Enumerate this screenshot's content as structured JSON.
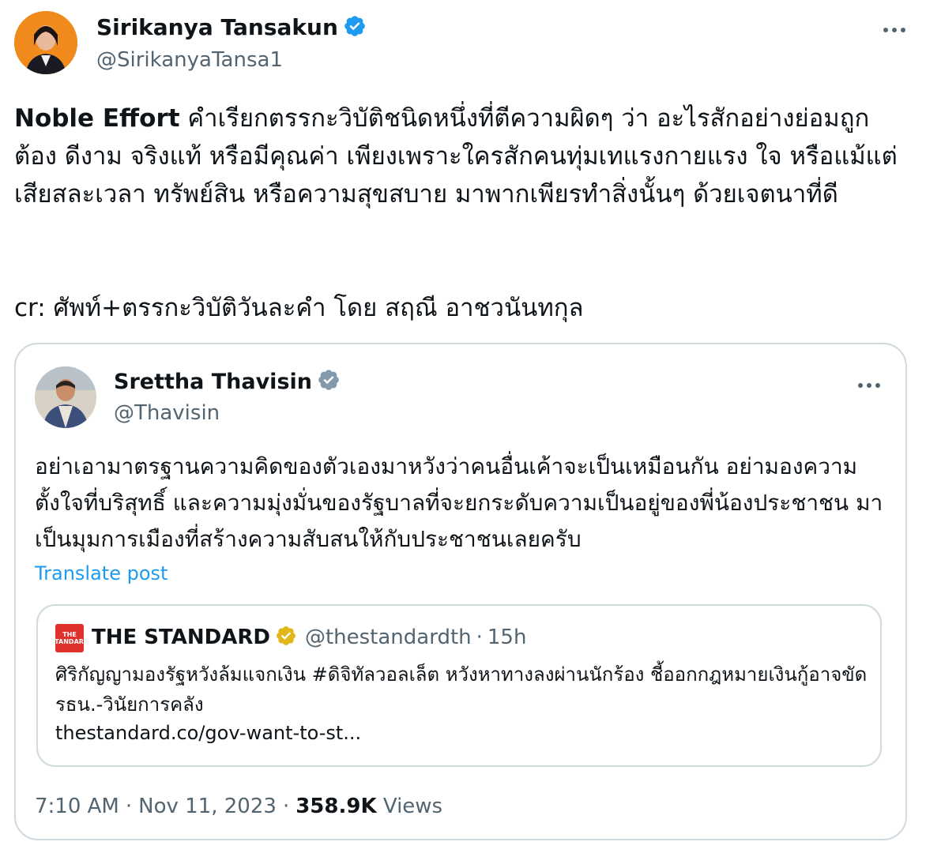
{
  "post": {
    "author_name": "Sirikanya Tansakun",
    "author_handle": "@SirikanyaTansa1",
    "text_bold": "Noble Effort",
    "text_rest": " คำเรียกตรรกะวิบัติชนิดหนึ่งที่ตีความผิดๆ ว่า อะไรสักอย่างย่อมถูกต้อง ดีงาม จริงแท้ หรือมีคุณค่า เพียงเพราะใครสักคนทุ่มเทแรงกายแรง ใจ หรือแม้แต่เสียสละเวลา ทรัพย์สิน หรือความสุขสบาย มาพากเพียรทำสิ่งนั้นๆ ด้วยเจตนาที่ดี",
    "credit": "cr: ศัพท์+ตรรกะวิบัติวันละคำ โดย สฤณี อาชวนันทกุล",
    "more_icon": "more-horizontal-icon",
    "verified_icon": "verified-badge-icon"
  },
  "quoted": {
    "author_name": "Srettha Thavisin",
    "author_handle": "@Thavisin",
    "text": "อย่าเอามาตรฐานความคิดของตัวเองมาหวังว่าคนอื่นเค้าจะเป็นเหมือนกัน อย่ามองความตั้งใจที่บริสุทธิ์ และความมุ่งมั่นของรัฐบาลที่จะยกระดับความเป็นอยู่ของพี่น้องประชาชน มาเป็นมุมการเมืองที่สร้างความสับสนให้กับประชาชนเลยครับ",
    "translate_label": "Translate post",
    "verified_icon": "grey-verified-badge-icon"
  },
  "nested": {
    "author_name": "THE STANDARD",
    "author_handle": "@thestandardth",
    "separator": "·",
    "time": "15h",
    "text": "ศิริกัญญามองรัฐหวังล้มแจกเงิน #ดิจิทัลวอลเล็ต หวังหาทางลงผ่านนักร้อง ชี้ออกกฎหมายเงินกู้อาจขัด รธน.-วินัยการคลัง",
    "link": "thestandard.co/gov-want-to-st...",
    "verified_icon": "gold-verified-badge-icon"
  },
  "meta": {
    "time": "7:10 AM",
    "date": "Nov 11, 2023",
    "separator": "·",
    "views_count": "358.9K",
    "views_label": "Views"
  },
  "colors": {
    "text": "#0f1419",
    "secondary": "#536471",
    "link": "#1d9bf0",
    "border": "#cfd9de",
    "verified_blue": "#1d9bf0",
    "verified_gold": "#e2b719",
    "standard_red": "#e0322d"
  }
}
